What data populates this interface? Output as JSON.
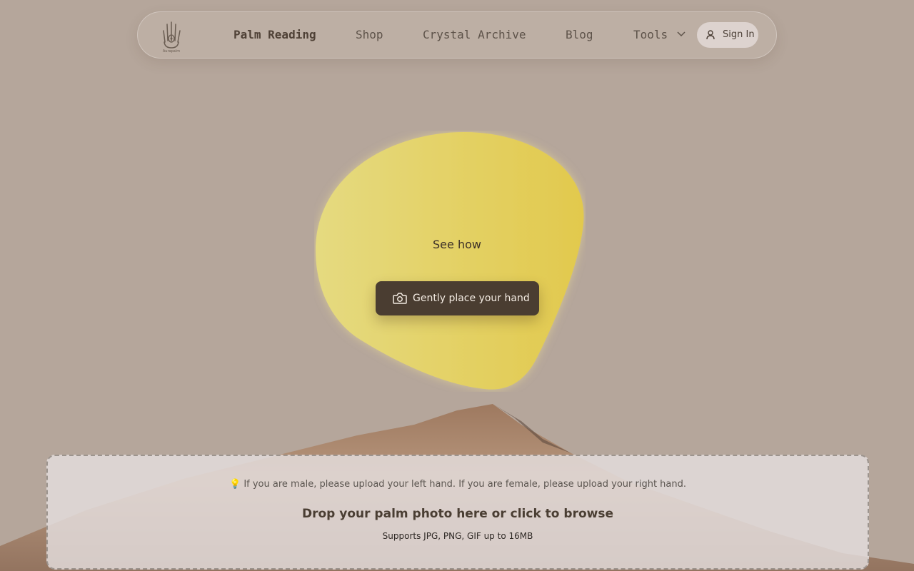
{
  "nav": {
    "logo_text": "Aurapalm",
    "links": [
      {
        "label": "Palm Reading",
        "active": true
      },
      {
        "label": "Shop"
      },
      {
        "label": "Crystal Archive"
      },
      {
        "label": "Blog"
      },
      {
        "label": "Tools",
        "icon": "chevron-down-icon"
      }
    ],
    "sign_in": {
      "label": "Sign In",
      "icon": "user-icon"
    }
  },
  "hero": {
    "headline": "See how",
    "cta": {
      "label": "Gently place your hand",
      "icon": "camera-icon"
    },
    "colors": {
      "blob_start": "#e5da80",
      "blob_end": "#e2c94d",
      "cta_bg": "#4a3d31"
    }
  },
  "upload": {
    "tip_icon": "lightbulb-icon",
    "tip": "💡 If you are male, please upload your left hand. If you are female, please upload your right hand.",
    "title": "Drop your palm photo here or click to browse",
    "supports": "Supports JPG, PNG, GIF up to 16MB"
  },
  "colors": {
    "background": "#b5a69b",
    "text_dark": "#4a3e33"
  }
}
